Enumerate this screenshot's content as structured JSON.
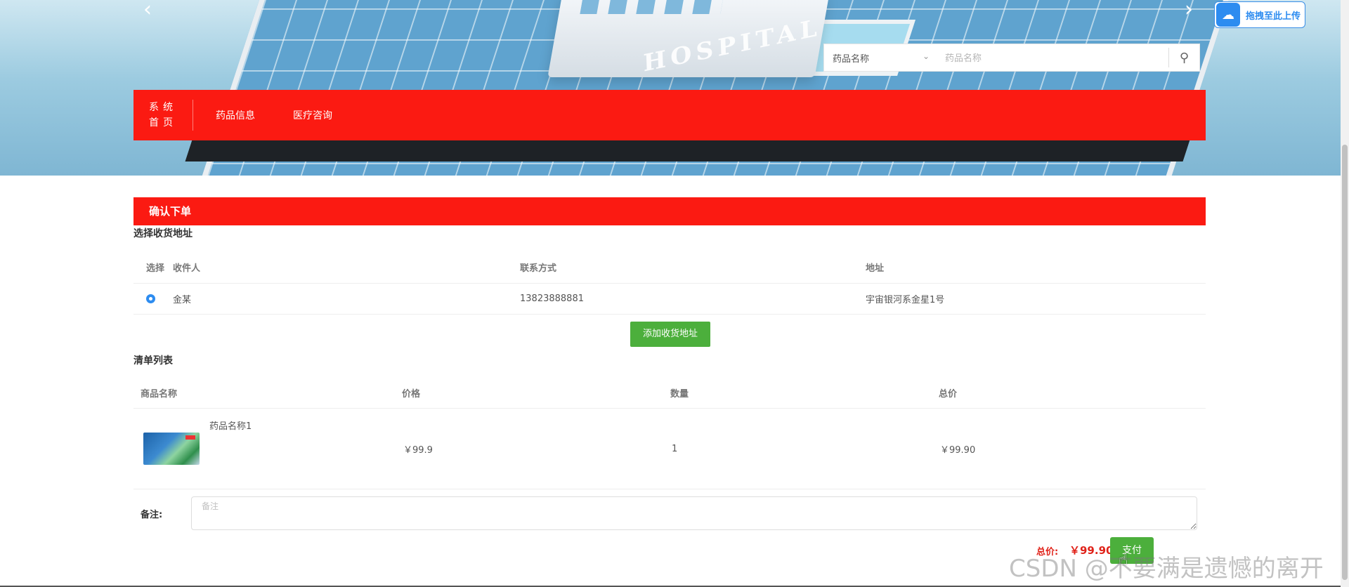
{
  "banner": {
    "building_label": "HOSPITAL",
    "prev_arrow": "‹",
    "next_arrow": "›"
  },
  "upload": {
    "label": "拖拽至此上传",
    "icon": "cloud-upload-icon"
  },
  "search": {
    "select_value": "药品名称",
    "placeholder": "药品名称",
    "icon": "search-icon"
  },
  "nav": {
    "home_line1": "系统",
    "home_line2": "首页",
    "items": [
      {
        "label": "药品信息"
      },
      {
        "label": "医疗咨询"
      }
    ]
  },
  "order": {
    "title": "确认下单",
    "address_section_title": "选择收货地址",
    "address_columns": [
      "选择",
      "收件人",
      "联系方式",
      "地址"
    ],
    "addresses": [
      {
        "recipient": "金某",
        "phone": "13823888881",
        "address": "宇宙银河系金星1号",
        "selected": true
      }
    ],
    "add_address_label": "添加收货地址",
    "list_section_title": "清单列表",
    "list_columns": [
      "商品名称",
      "价格",
      "数量",
      "总价"
    ],
    "items": [
      {
        "name": "药品名称1",
        "price": "￥99.9",
        "quantity": "1",
        "total": "￥99.90"
      }
    ],
    "remark_label": "备注:",
    "remark_placeholder": "备注",
    "total_label": "总价:",
    "total_value": "￥99.90",
    "pay_label": "支付"
  },
  "watermark": "CSDN @不要满是遗憾的离开",
  "colors": {
    "primary_red": "#fb1a12",
    "button_green": "#4caf3c",
    "price_red": "#e0231a",
    "accent_blue": "#2d8cf0"
  }
}
